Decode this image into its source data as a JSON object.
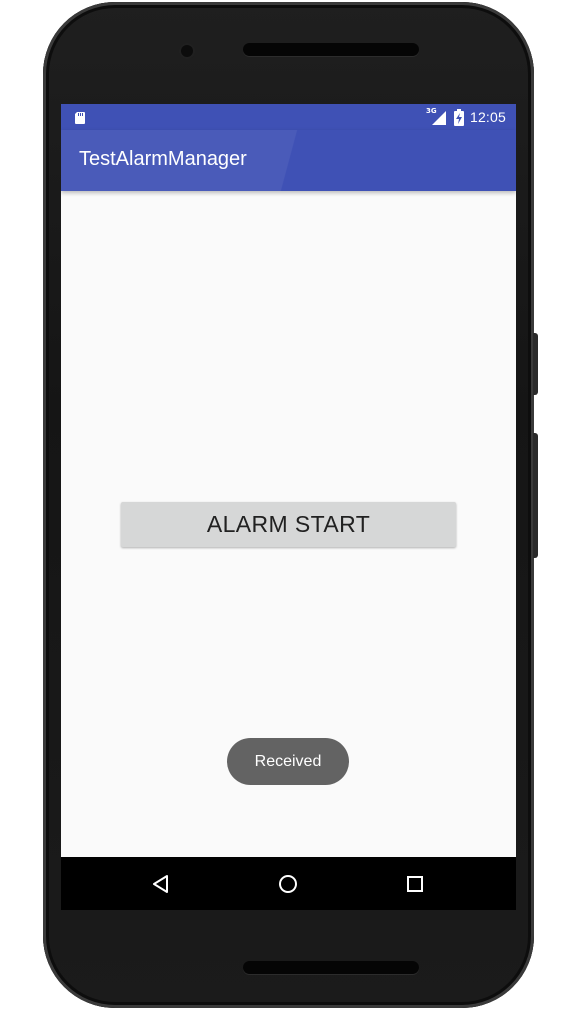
{
  "status_bar": {
    "left_icon": "sd-card-icon",
    "network_label": "3G",
    "signal_icon": "signal-icon",
    "battery_icon": "battery-charging-icon",
    "time": "12:05"
  },
  "app_bar": {
    "title": "TestAlarmManager"
  },
  "main": {
    "alarm_button_label": "ALARM START"
  },
  "toast": {
    "message": "Received"
  },
  "nav_bar": {
    "back_icon": "back-icon",
    "home_icon": "home-icon",
    "recents_icon": "recents-icon"
  },
  "colors": {
    "primary": "#3f51b5",
    "background": "#fafafa",
    "button": "#d6d7d7",
    "toast": "#636363",
    "nav_bar": "#000000"
  }
}
